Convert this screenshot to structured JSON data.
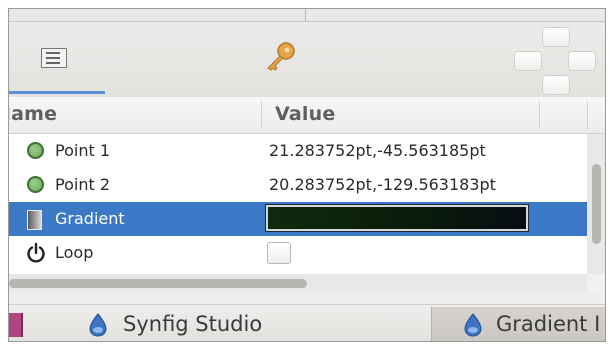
{
  "toolbar": {
    "tabs": [
      {
        "icon": "params-panel-icon"
      },
      {
        "icon": "key-icon"
      }
    ]
  },
  "header": {
    "name_col": "Name",
    "value_col": "Value"
  },
  "params": [
    {
      "icon": "point-circle-icon",
      "name": "Point 1",
      "value": "21.283752pt,-45.563185pt"
    },
    {
      "icon": "point-circle-icon",
      "name": "Point 2",
      "value": "20.283752pt,-129.563183pt"
    },
    {
      "icon": "gradient-icon",
      "name": "Gradient",
      "value": "",
      "selected": true
    },
    {
      "icon": "power-icon",
      "name": "Loop",
      "value": ""
    }
  ],
  "taskbar": {
    "items": [
      {
        "label": "Synfig Studio",
        "icon": "synfig-icon"
      },
      {
        "label": "Gradient I",
        "icon": "synfig-icon",
        "active": true
      }
    ]
  },
  "colors": {
    "selection": "#3b79c7",
    "tab_underline": "#5b93d4",
    "point_icon": "#7cb86a"
  }
}
